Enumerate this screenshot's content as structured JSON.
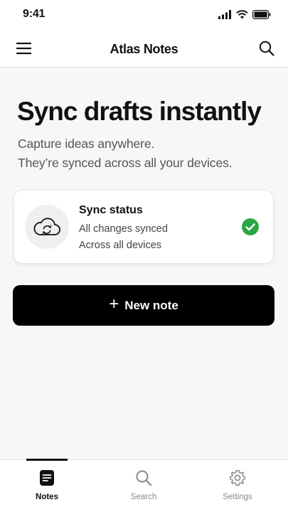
{
  "status_bar": {
    "time": "9:41"
  },
  "header": {
    "title": "Atlas Notes",
    "menu_icon": "menu-icon",
    "search_icon": "search-icon"
  },
  "hero": {
    "title": "Sync drafts instantly",
    "subtitle_line1": "Capture ideas anywhere.",
    "subtitle_line2": "They’re synced across all your devices."
  },
  "sync_card": {
    "title": "Sync status",
    "line1": "All changes synced",
    "line2": "Across all devices",
    "icon": "cloud-sync-icon",
    "status_icon": "check-circle-icon",
    "status_color": "#2aa745"
  },
  "new_note": {
    "plus": "+",
    "label": "New note"
  },
  "tabs": [
    {
      "label": "Notes",
      "icon": "note-icon",
      "active": true
    },
    {
      "label": "Search",
      "icon": "search-icon",
      "active": false
    },
    {
      "label": "Settings",
      "icon": "gear-icon",
      "active": false
    }
  ],
  "colors": {
    "primary": "#000000",
    "success": "#2aa745",
    "background": "#f7f7f7"
  }
}
